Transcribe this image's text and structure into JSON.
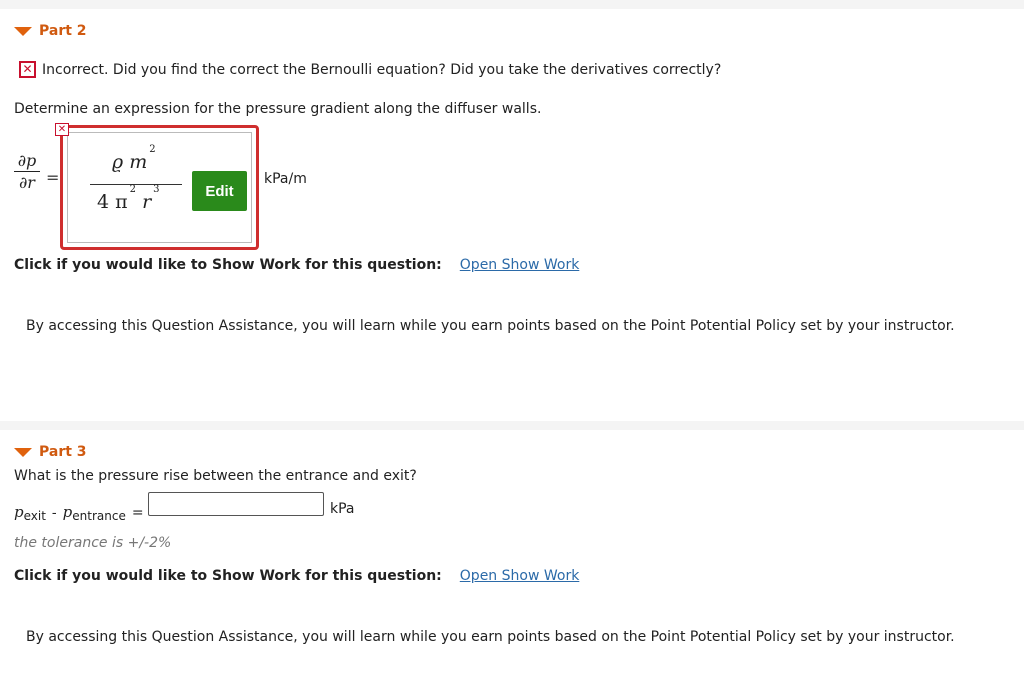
{
  "part2": {
    "title": "Part 2",
    "feedback": "Incorrect. Did you find the correct the Bernoulli equation? Did you take the derivatives correctly?",
    "question": "Determine an expression for the pressure gradient along the diffuser walls.",
    "lhs_num": "∂p",
    "lhs_den": "∂r",
    "equals": "=",
    "expr_num_rho": "ϱ",
    "expr_num_m": "m",
    "expr_num_exp": "2",
    "expr_den_coef": "4",
    "expr_den_pi": "π",
    "expr_den_pi_exp": "2",
    "expr_den_r": "r",
    "expr_den_r_exp": "3",
    "edit_label": "Edit",
    "unit": "kPa/m",
    "showwork_label": "Click if you would like to Show Work for this question:",
    "showwork_link": "Open Show Work",
    "assist_text": "By accessing this Question Assistance, you will learn while you earn points based on the Point Potential Policy set by your instructor."
  },
  "part3": {
    "title": "Part 3",
    "question": "What is the pressure rise between the entrance and exit?",
    "p_exit": "p",
    "sub_exit": "exit",
    "minus": "-",
    "p_entrance": "p",
    "sub_entrance": "entrance",
    "equals": "=",
    "input_value": "",
    "unit": "kPa",
    "tolerance": "the tolerance is +/-2%",
    "showwork_label": "Click if you would like to Show Work for this question:",
    "showwork_link": "Open Show Work",
    "assist_text": "By accessing this Question Assistance, you will learn while you earn points based on the Point Potential Policy set by your instructor."
  },
  "colors": {
    "accent": "#d05a10",
    "error": "#c8102e",
    "edit_button": "#2a8a1b",
    "link": "#2b6aa8"
  }
}
